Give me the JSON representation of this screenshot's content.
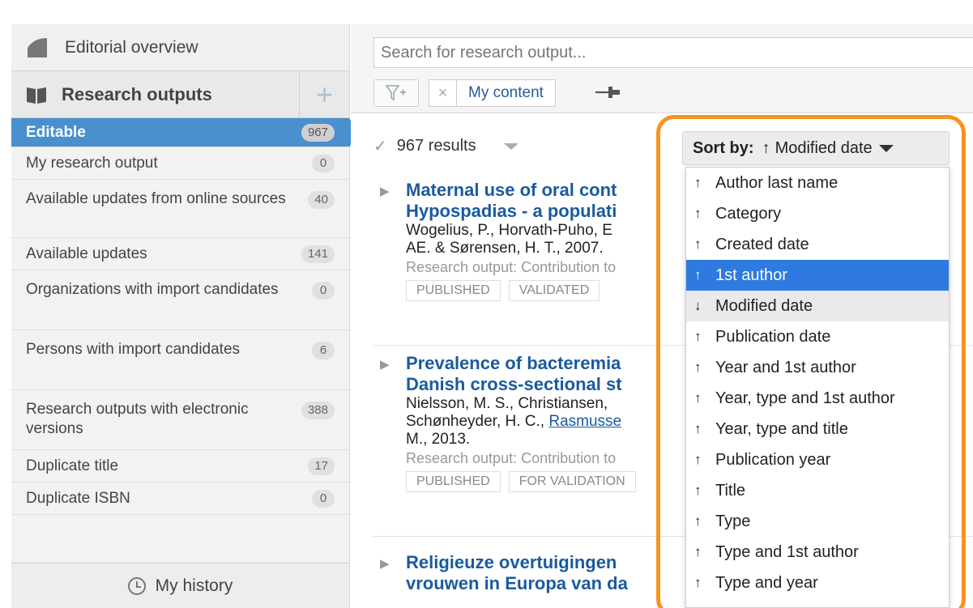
{
  "sidebar": {
    "top_link": "Editorial overview",
    "section_title": "Research outputs",
    "add_symbol": "+",
    "items": [
      {
        "label": "Editable",
        "count": "967",
        "active": true
      },
      {
        "label": "My research output",
        "count": "0"
      },
      {
        "label": "Available updates from online sources",
        "count": "40"
      },
      {
        "label": "Available updates",
        "count": "141"
      },
      {
        "label": "Organizations with import candidates",
        "count": "0"
      },
      {
        "label": "Persons with import candidates",
        "count": "6"
      },
      {
        "label": "Research outputs with electronic versions",
        "count": "388"
      },
      {
        "label": "Duplicate title",
        "count": "17"
      },
      {
        "label": "Duplicate ISBN",
        "count": "0"
      }
    ],
    "footer": "My history"
  },
  "search": {
    "placeholder": "Search for research output..."
  },
  "filters": {
    "chip_label": "My content",
    "chip_close": "×"
  },
  "results": {
    "count_label": "967 results",
    "items": [
      {
        "title_line1": "Maternal use of oral cont",
        "title_line2": "Hypospadias - a populati",
        "authors_line1": "Wogelius, P., Horvath-Puho, E",
        "authors_line2": "AE. & Sørensen, H. T., 2007.",
        "meta": "Research output: Contribution to",
        "tags": [
          "PUBLISHED",
          "VALIDATED"
        ]
      },
      {
        "title_line1": "Prevalence of bacteremia",
        "title_line2": "Danish cross-sectional st",
        "authors_line1": "Nielsson, M. S., Christiansen,",
        "authors_line2a": "Schønheyder, H. C., ",
        "authors_line2b": "Rasmusse",
        "authors_line3": "M., 2013.",
        "meta": "Research output: Contribution to",
        "tags": [
          "PUBLISHED",
          "FOR VALIDATION"
        ]
      },
      {
        "title_line1": "Religieuze overtuigingen",
        "title_line2": "vrouwen in Europa van da"
      }
    ]
  },
  "sort": {
    "label": "Sort by:",
    "current": "Modified date",
    "options": [
      {
        "label": "Author last name",
        "dir": "↑"
      },
      {
        "label": "Category",
        "dir": "↑"
      },
      {
        "label": "Created date",
        "dir": "↑"
      },
      {
        "label": "1st author",
        "dir": "↑",
        "selected": true
      },
      {
        "label": "Modified date",
        "dir": "↓",
        "current": true
      },
      {
        "label": "Publication date",
        "dir": "↑"
      },
      {
        "label": "Year and 1st author",
        "dir": "↑"
      },
      {
        "label": "Year, type and 1st author",
        "dir": "↑"
      },
      {
        "label": "Year, type and title",
        "dir": "↑"
      },
      {
        "label": "Publication year",
        "dir": "↑"
      },
      {
        "label": "Title",
        "dir": "↑"
      },
      {
        "label": "Type",
        "dir": "↑"
      },
      {
        "label": "Type and 1st author",
        "dir": "↑"
      },
      {
        "label": "Type and year",
        "dir": "↑"
      }
    ]
  },
  "colors": {
    "accent": "#4a90cf",
    "highlight": "#f7931e",
    "link": "#1a5a9f",
    "selected": "#2f7ae0"
  }
}
